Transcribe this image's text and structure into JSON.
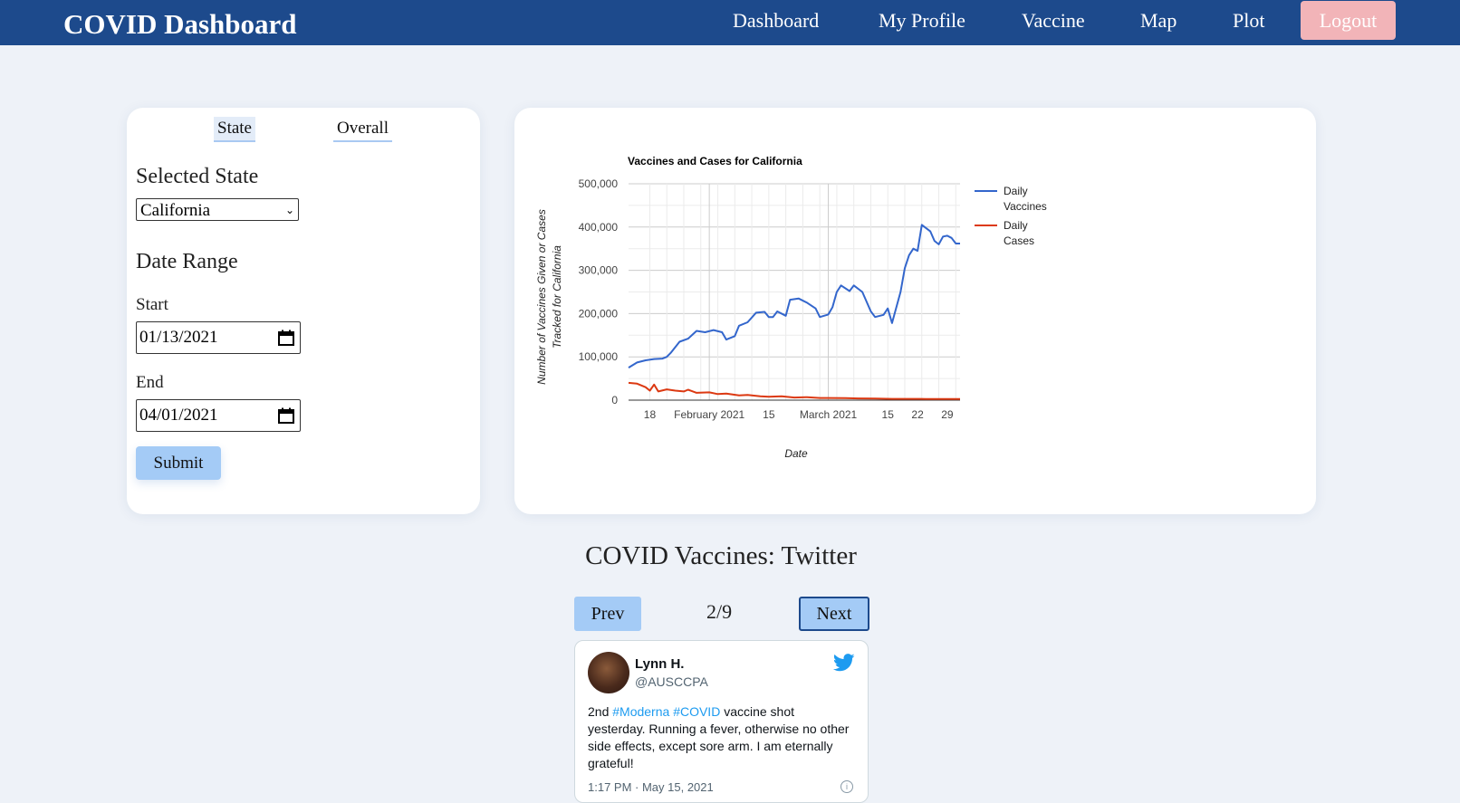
{
  "navbar": {
    "brand": "COVID Dashboard",
    "links": [
      "Dashboard",
      "My Profile",
      "Vaccine",
      "Map",
      "Plot"
    ],
    "logout_label": "Logout"
  },
  "sidebar": {
    "tabs": [
      "State",
      "Overall"
    ],
    "selected_state_label": "Selected State",
    "state_value": "California",
    "date_range_label": "Date Range",
    "start_label": "Start",
    "start_value": "01/13/2021",
    "end_label": "End",
    "end_value": "04/01/2021",
    "submit_label": "Submit"
  },
  "chart_data": {
    "type": "line",
    "title": "Vaccines and Cases for California",
    "xlabel": "Date",
    "ylabel_lines": [
      "Number of Vaccines Given or Cases",
      "Tracked for California"
    ],
    "ylim": [
      0,
      500000
    ],
    "yticks": [
      "500,000",
      "400,000",
      "300,000",
      "200,000",
      "100,000",
      "0"
    ],
    "x_start": "2021-01-13",
    "x_end": "2021-04-01",
    "xticks": [
      {
        "label": "18",
        "date": "2021-01-18"
      },
      {
        "label": "February 2021",
        "date": "2021-02-01"
      },
      {
        "label": "15",
        "date": "2021-02-15"
      },
      {
        "label": "March 2021",
        "date": "2021-03-01"
      },
      {
        "label": "15",
        "date": "2021-03-15"
      },
      {
        "label": "22",
        "date": "2021-03-22"
      },
      {
        "label": "29",
        "date": "2021-03-29"
      }
    ],
    "grid": true,
    "legend_position": "right",
    "series": [
      {
        "name": "Daily Vaccines",
        "legend_lines": [
          "Daily",
          "Vaccines"
        ],
        "color": "#3366cc",
        "points": [
          [
            "2021-01-13",
            75000
          ],
          [
            "2021-01-15",
            87000
          ],
          [
            "2021-01-17",
            92000
          ],
          [
            "2021-01-19",
            95000
          ],
          [
            "2021-01-21",
            96000
          ],
          [
            "2021-01-22",
            100000
          ],
          [
            "2021-01-23",
            110000
          ],
          [
            "2021-01-25",
            135000
          ],
          [
            "2021-01-27",
            142000
          ],
          [
            "2021-01-29",
            160000
          ],
          [
            "2021-01-31",
            157000
          ],
          [
            "2021-02-02",
            162000
          ],
          [
            "2021-02-04",
            157000
          ],
          [
            "2021-02-05",
            140000
          ],
          [
            "2021-02-07",
            148000
          ],
          [
            "2021-02-08",
            172000
          ],
          [
            "2021-02-10",
            180000
          ],
          [
            "2021-02-12",
            202000
          ],
          [
            "2021-02-14",
            204000
          ],
          [
            "2021-02-15",
            192000
          ],
          [
            "2021-02-16",
            192000
          ],
          [
            "2021-02-17",
            205000
          ],
          [
            "2021-02-19",
            195000
          ],
          [
            "2021-02-20",
            232000
          ],
          [
            "2021-02-22",
            235000
          ],
          [
            "2021-02-24",
            225000
          ],
          [
            "2021-02-26",
            212000
          ],
          [
            "2021-02-27",
            192000
          ],
          [
            "2021-03-01",
            198000
          ],
          [
            "2021-03-02",
            215000
          ],
          [
            "2021-03-03",
            250000
          ],
          [
            "2021-03-04",
            265000
          ],
          [
            "2021-03-06",
            252000
          ],
          [
            "2021-03-07",
            265000
          ],
          [
            "2021-03-09",
            250000
          ],
          [
            "2021-03-11",
            205000
          ],
          [
            "2021-03-12",
            192000
          ],
          [
            "2021-03-14",
            197000
          ],
          [
            "2021-03-15",
            212000
          ],
          [
            "2021-03-16",
            178000
          ],
          [
            "2021-03-18",
            250000
          ],
          [
            "2021-03-19",
            305000
          ],
          [
            "2021-03-20",
            335000
          ],
          [
            "2021-03-21",
            350000
          ],
          [
            "2021-03-22",
            345000
          ],
          [
            "2021-03-23",
            405000
          ],
          [
            "2021-03-25",
            390000
          ],
          [
            "2021-03-26",
            368000
          ],
          [
            "2021-03-27",
            360000
          ],
          [
            "2021-03-28",
            378000
          ],
          [
            "2021-03-29",
            380000
          ],
          [
            "2021-03-30",
            375000
          ],
          [
            "2021-03-31",
            362000
          ],
          [
            "2021-04-01",
            362000
          ]
        ]
      },
      {
        "name": "Daily Cases",
        "legend_lines": [
          "Daily",
          "Cases"
        ],
        "color": "#dc3912",
        "points": [
          [
            "2021-01-13",
            40000
          ],
          [
            "2021-01-15",
            38000
          ],
          [
            "2021-01-17",
            30000
          ],
          [
            "2021-01-18",
            22000
          ],
          [
            "2021-01-19",
            36000
          ],
          [
            "2021-01-20",
            20000
          ],
          [
            "2021-01-22",
            25000
          ],
          [
            "2021-01-24",
            22000
          ],
          [
            "2021-01-26",
            20000
          ],
          [
            "2021-01-27",
            24000
          ],
          [
            "2021-01-29",
            17000
          ],
          [
            "2021-02-01",
            18000
          ],
          [
            "2021-02-03",
            14000
          ],
          [
            "2021-02-05",
            15000
          ],
          [
            "2021-02-08",
            11000
          ],
          [
            "2021-02-10",
            12000
          ],
          [
            "2021-02-13",
            9000
          ],
          [
            "2021-02-15",
            8000
          ],
          [
            "2021-02-18",
            9000
          ],
          [
            "2021-02-21",
            6000
          ],
          [
            "2021-02-24",
            7000
          ],
          [
            "2021-02-27",
            5000
          ],
          [
            "2021-03-01",
            5000
          ],
          [
            "2021-03-05",
            4500
          ],
          [
            "2021-03-08",
            4000
          ],
          [
            "2021-03-12",
            3500
          ],
          [
            "2021-03-16",
            3000
          ],
          [
            "2021-03-20",
            3000
          ],
          [
            "2021-03-24",
            2800
          ],
          [
            "2021-03-28",
            2500
          ],
          [
            "2021-04-01",
            2500
          ]
        ]
      }
    ]
  },
  "twitter": {
    "title": "COVID Vaccines: Twitter",
    "prev_label": "Prev",
    "next_label": "Next",
    "page_indicator": "2/9",
    "tweet": {
      "name": "Lynn H.",
      "handle": "@AUSCCPA",
      "text_before": "2nd ",
      "hashtag1": "#Moderna",
      "hashtag2": "#COVID",
      "text_after": " vaccine shot yesterday.  Running a fever, otherwise no other side effects, except sore arm.  I am eternally grateful!",
      "timestamp": "1:17 PM · May 15, 2021"
    }
  }
}
